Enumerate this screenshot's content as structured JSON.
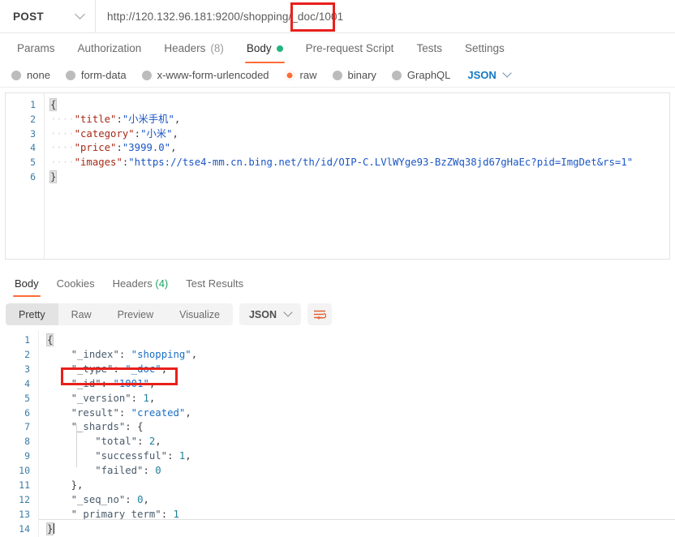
{
  "request": {
    "method": "POST",
    "method_icon": "chevron-down-icon",
    "url": "http://120.132.96.181:9200/shopping/_doc/1001",
    "url_prefix": "http://120.132.96.181:9200/shopping/_doc",
    "url_highlight": "/1001",
    "tabs": [
      {
        "label": "Params",
        "active": false
      },
      {
        "label": "Authorization",
        "active": false
      },
      {
        "label": "Headers",
        "count": "(8)",
        "active": false
      },
      {
        "label": "Body",
        "active": true,
        "dot": "green-dot-icon"
      },
      {
        "label": "Pre-request Script",
        "active": false
      },
      {
        "label": "Tests",
        "active": false
      },
      {
        "label": "Settings",
        "active": false
      }
    ],
    "body_types": [
      {
        "label": "none",
        "selected": false
      },
      {
        "label": "form-data",
        "selected": false
      },
      {
        "label": "x-www-form-urlencoded",
        "selected": false
      },
      {
        "label": "raw",
        "selected": true
      },
      {
        "label": "binary",
        "selected": false
      },
      {
        "label": "GraphQL",
        "selected": false
      }
    ],
    "raw_format": "JSON",
    "raw_format_icon": "chevron-down-icon",
    "body_line_numbers": [
      "1",
      "2",
      "3",
      "4",
      "5",
      "6"
    ],
    "body_lines": [
      {
        "open_brace": "{"
      },
      {
        "indent": "····",
        "key": "\"title\"",
        "colon": ":",
        "value": "\"小米手机\"",
        "comma": ","
      },
      {
        "indent": "····",
        "key": "\"category\"",
        "colon": ":",
        "value": "\"小米\"",
        "comma": ","
      },
      {
        "indent": "····",
        "key": "\"price\"",
        "colon": ":",
        "value": "\"3999.0\"",
        "comma": ","
      },
      {
        "indent": "····",
        "key": "\"images\"",
        "colon": ":",
        "value": "\"https://tse4-mm.cn.bing.net/th/id/OIP-C.LVlWYge93-BzZWq38jd67gHaEc?pid=ImgDet&rs=1\"",
        "comma": ""
      },
      {
        "close_brace": "}"
      }
    ]
  },
  "response": {
    "tabs": [
      {
        "label": "Body",
        "active": true
      },
      {
        "label": "Cookies",
        "active": false
      },
      {
        "label": "Headers",
        "count": "(4)",
        "active": false
      },
      {
        "label": "Test Results",
        "active": false
      }
    ],
    "view_modes": [
      {
        "label": "Pretty",
        "active": true
      },
      {
        "label": "Raw",
        "active": false
      },
      {
        "label": "Preview",
        "active": false
      },
      {
        "label": "Visualize",
        "active": false
      }
    ],
    "format": "JSON",
    "format_icon": "chevron-down-icon",
    "wrap_icon": "wrap-text-icon",
    "line_numbers": [
      "1",
      "2",
      "3",
      "4",
      "5",
      "6",
      "7",
      "8",
      "9",
      "10",
      "11",
      "12",
      "13",
      "14"
    ],
    "lines": [
      {
        "indent": "",
        "text_brace": "{"
      },
      {
        "indent": "    ",
        "key": "\"_index\"",
        "colon": ": ",
        "value": "\"shopping\"",
        "vtype": "string",
        "comma": ","
      },
      {
        "indent": "    ",
        "key": "\"_type\"",
        "colon": ": ",
        "value": "\"_doc\"",
        "vtype": "string",
        "comma": ","
      },
      {
        "indent": "    ",
        "key": "\"_id\"",
        "colon": ": ",
        "value": "\"1001\"",
        "vtype": "string",
        "comma": ","
      },
      {
        "indent": "    ",
        "key": "\"_version\"",
        "colon": ": ",
        "value": "1",
        "vtype": "number",
        "comma": ","
      },
      {
        "indent": "    ",
        "key": "\"result\"",
        "colon": ": ",
        "value": "\"created\"",
        "vtype": "string",
        "comma": ","
      },
      {
        "indent": "    ",
        "key": "\"_shards\"",
        "colon": ": ",
        "value": "{",
        "vtype": "brace",
        "comma": ""
      },
      {
        "indent": "        ",
        "key": "\"total\"",
        "colon": ": ",
        "value": "2",
        "vtype": "number",
        "comma": ","
      },
      {
        "indent": "        ",
        "key": "\"successful\"",
        "colon": ": ",
        "value": "1",
        "vtype": "number",
        "comma": ","
      },
      {
        "indent": "        ",
        "key": "\"failed\"",
        "colon": ": ",
        "value": "0",
        "vtype": "number",
        "comma": ""
      },
      {
        "indent": "    ",
        "key": "",
        "colon": "",
        "value": "},",
        "vtype": "brace",
        "comma": ""
      },
      {
        "indent": "    ",
        "key": "\"_seq_no\"",
        "colon": ": ",
        "value": "0",
        "vtype": "number",
        "comma": ","
      },
      {
        "indent": "    ",
        "key": "\"_primary_term\"",
        "colon": ": ",
        "value": "1",
        "vtype": "number",
        "comma": ""
      },
      {
        "indent": "",
        "text_brace": "}"
      }
    ]
  },
  "annotations": {
    "highlight_color": "#e8201c",
    "boxes": [
      {
        "name": "url-id-highlight",
        "target": "1001"
      },
      {
        "name": "response-id-highlight",
        "target": "\"_id\": \"1001\","
      }
    ]
  },
  "colors": {
    "accent": "#ff6c37",
    "link": "#1478c4",
    "success": "#24b47e",
    "header_count": "#1fa463"
  }
}
